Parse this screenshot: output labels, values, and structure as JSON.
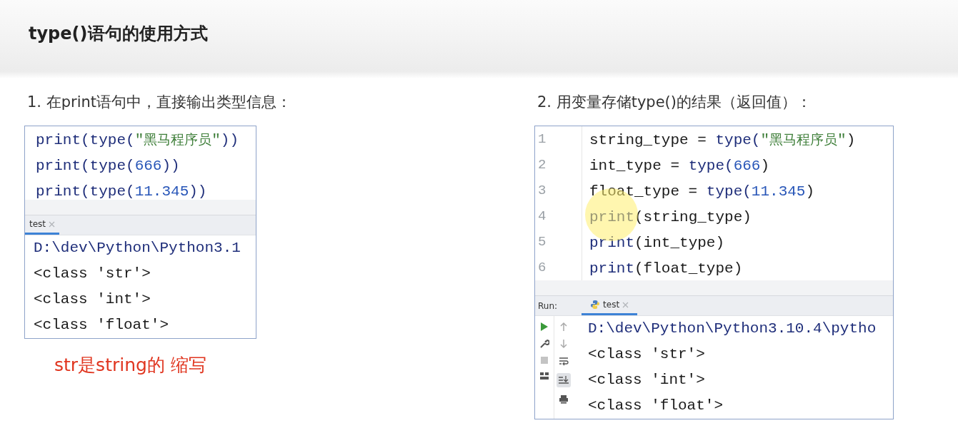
{
  "slide": {
    "title": "type()语句的使用方式"
  },
  "sections": [
    {
      "kind": "compact",
      "heading": "1. 在print语句中，直接输出类型信息：",
      "editor": {
        "lines": [
          {
            "tokens": [
              {
                "t": "print(type(",
                "kind": "call"
              },
              {
                "t": "\"黑马程序员\"",
                "kind": "string"
              },
              {
                "t": "))",
                "kind": "call"
              }
            ]
          },
          {
            "tokens": [
              {
                "t": "print(type(",
                "kind": "call"
              },
              {
                "t": "666",
                "kind": "number"
              },
              {
                "t": "))",
                "kind": "call"
              }
            ]
          },
          {
            "tokens": [
              {
                "t": "print(type(",
                "kind": "call"
              },
              {
                "t": "11.345",
                "kind": "number"
              },
              {
                "t": "))",
                "kind": "call"
              }
            ]
          }
        ]
      },
      "run": {
        "tab": "test",
        "output": [
          {
            "text": "D:\\dev\\Python\\Python3.1",
            "kind": "path"
          },
          {
            "text": "<class 'str'>",
            "kind": "result"
          },
          {
            "text": "<class 'int'>",
            "kind": "result"
          },
          {
            "text": "<class 'float'>",
            "kind": "result"
          }
        ]
      },
      "note": "str是string的 缩写"
    },
    {
      "kind": "full",
      "heading": "2. 用变量存储type()的结果（返回值）：",
      "editor": {
        "lines": [
          {
            "number": "1",
            "tokens": [
              {
                "t": "string_type = ",
                "kind": "text"
              },
              {
                "t": "type(",
                "kind": "call"
              },
              {
                "t": "\"黑马程序员\"",
                "kind": "string"
              },
              {
                "t": ")",
                "kind": "text"
              }
            ]
          },
          {
            "number": "2",
            "tokens": [
              {
                "t": "int_type = ",
                "kind": "text"
              },
              {
                "t": "type(",
                "kind": "call"
              },
              {
                "t": "666",
                "kind": "number"
              },
              {
                "t": ")",
                "kind": "text"
              }
            ]
          },
          {
            "number": "3",
            "tokens": [
              {
                "t": "float_type = ",
                "kind": "text"
              },
              {
                "t": "type(",
                "kind": "call"
              },
              {
                "t": "11.345",
                "kind": "number"
              },
              {
                "t": ")",
                "kind": "text"
              }
            ]
          },
          {
            "number": "4",
            "tokens": [
              {
                "t": "print",
                "kind": "call"
              },
              {
                "t": "(string_type)",
                "kind": "text"
              }
            ]
          },
          {
            "number": "5",
            "tokens": [
              {
                "t": "print",
                "kind": "call"
              },
              {
                "t": "(int_type)",
                "kind": "text"
              }
            ]
          },
          {
            "number": "6",
            "tokens": [
              {
                "t": "print",
                "kind": "call"
              },
              {
                "t": "(float_type)",
                "kind": "text"
              }
            ]
          }
        ]
      },
      "run": {
        "label": "Run:",
        "tab": "test",
        "output": [
          {
            "text": "D:\\dev\\Python\\Python3.10.4\\pytho",
            "kind": "path"
          },
          {
            "text": "<class 'str'>",
            "kind": "result"
          },
          {
            "text": "<class 'int'>",
            "kind": "result"
          },
          {
            "text": "<class 'float'>",
            "kind": "result"
          }
        ]
      }
    }
  ]
}
